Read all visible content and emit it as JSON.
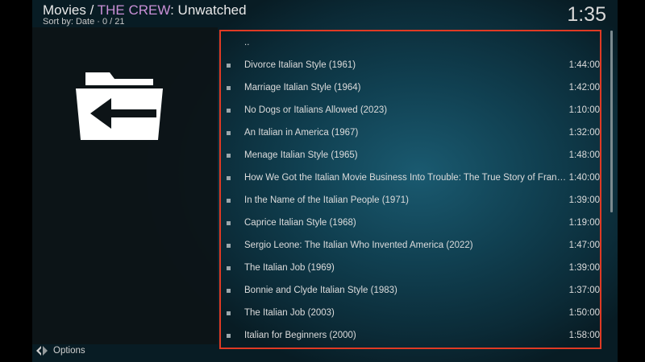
{
  "header": {
    "section": "Movies",
    "separator": " / ",
    "source": "THE CREW",
    "filter": ": Unwatched",
    "sort_text": "Sort by: Date",
    "dot": "·",
    "position": "0 / 21",
    "clock": "1:35"
  },
  "icons": {
    "back_folder": "folder-back-arrow-icon",
    "options": "diamond-arrows-icon",
    "bullet": "square-bullet-icon"
  },
  "colors": {
    "accent": "#c98fd6",
    "highlight_border": "#e03a24"
  },
  "list": {
    "parent_label": "..",
    "items": [
      {
        "title": "Divorce Italian Style (1961)",
        "duration": "1:44:00"
      },
      {
        "title": "Marriage Italian Style (1964)",
        "duration": "1:42:00"
      },
      {
        "title": "No Dogs or Italians Allowed (2023)",
        "duration": "1:10:00"
      },
      {
        "title": "An Italian in America (1967)",
        "duration": "1:32:00"
      },
      {
        "title": "Menage Italian Style (1965)",
        "duration": "1:48:00"
      },
      {
        "title": "How We Got the Italian Movie Business Into Trouble: The True Story of Franc...",
        "duration": "1:40:00"
      },
      {
        "title": "In the Name of the Italian People (1971)",
        "duration": "1:39:00"
      },
      {
        "title": "Caprice Italian Style (1968)",
        "duration": "1:19:00"
      },
      {
        "title": "Sergio Leone: The Italian Who Invented America (2022)",
        "duration": "1:47:00"
      },
      {
        "title": "The Italian Job (1969)",
        "duration": "1:39:00"
      },
      {
        "title": "Bonnie and Clyde Italian Style (1983)",
        "duration": "1:37:00"
      },
      {
        "title": "The Italian Job (2003)",
        "duration": "1:50:00"
      },
      {
        "title": "Italian for Beginners (2000)",
        "duration": "1:58:00"
      }
    ]
  },
  "footer": {
    "options_label": "Options"
  }
}
